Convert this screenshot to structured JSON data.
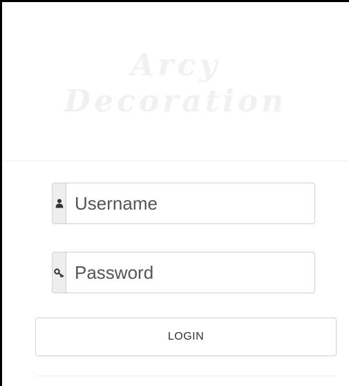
{
  "brand": {
    "line1": "Arcy",
    "line2": "Decoration"
  },
  "login_form": {
    "username": {
      "placeholder": "Username",
      "value": "",
      "icon": "user-icon"
    },
    "password": {
      "placeholder": "Password",
      "value": "",
      "icon": "key-icon"
    },
    "submit_label": "LOGIN"
  },
  "colors": {
    "brand_text": "#f1f1f1",
    "addon_bg": "#eeeeee",
    "border": "#cfcfcf",
    "text": "#555555"
  }
}
